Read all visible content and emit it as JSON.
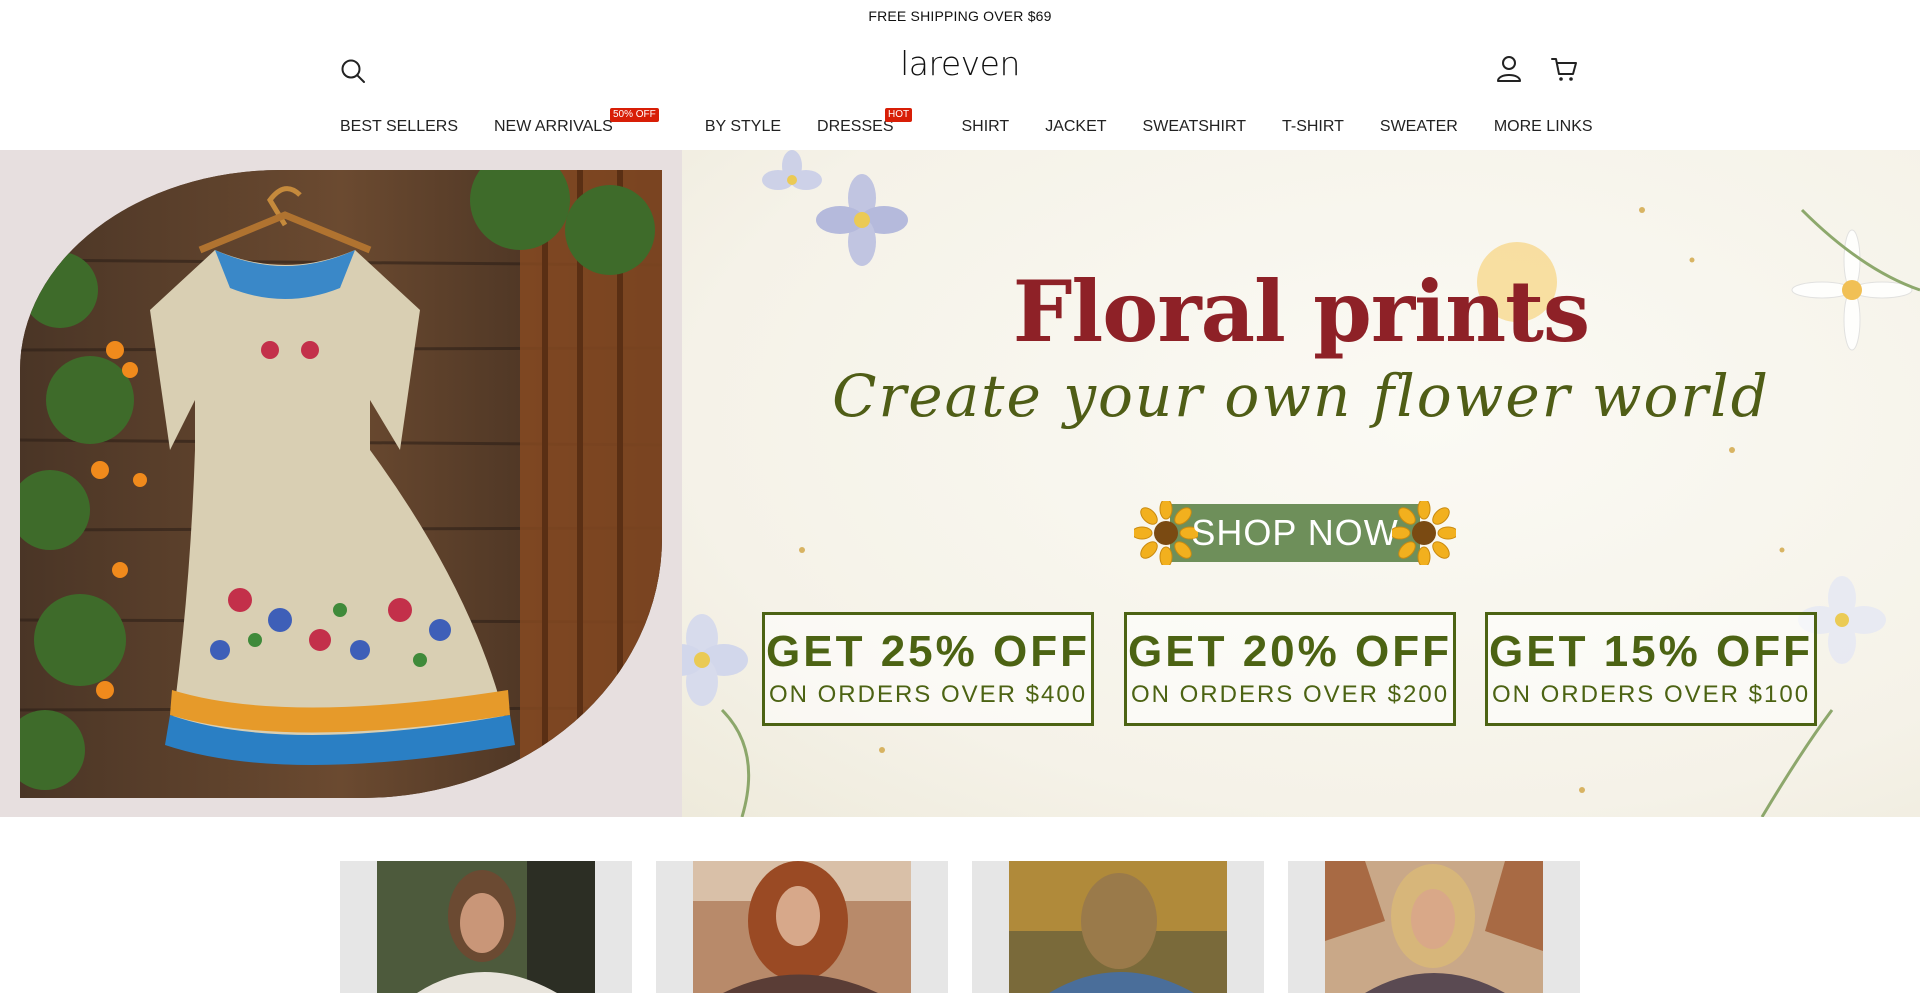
{
  "announcement": "FREE SHIPPING OVER $69",
  "header": {
    "logo": "lareven",
    "icons": {
      "search": "search-icon",
      "account": "user-icon",
      "cart": "cart-icon"
    }
  },
  "nav": [
    {
      "label": "BEST SELLERS",
      "badge": ""
    },
    {
      "label": "NEW ARRIVALS",
      "badge": "50% OFF"
    },
    {
      "label": "BY STYLE",
      "badge": ""
    },
    {
      "label": "DRESSES",
      "badge": "HOT"
    },
    {
      "label": "SHIRT",
      "badge": ""
    },
    {
      "label": "JACKET",
      "badge": ""
    },
    {
      "label": "SWEATSHIRT",
      "badge": ""
    },
    {
      "label": "T-SHIRT",
      "badge": ""
    },
    {
      "label": "SWEATER",
      "badge": ""
    },
    {
      "label": "MORE LINKS",
      "badge": ""
    }
  ],
  "hero": {
    "title": "Floral prints",
    "subtitle": "Create your own flower world",
    "cta": "SHOP NOW",
    "offers": [
      {
        "headline": "GET 25% OFF",
        "condition": "ON ORDERS OVER $400"
      },
      {
        "headline": "GET 20% OFF",
        "condition": "ON ORDERS OVER $200"
      },
      {
        "headline": "GET 15% OFF",
        "condition": "ON ORDERS OVER $100"
      }
    ]
  },
  "colors": {
    "title": "#8e2127",
    "subtitle": "#4f5d16",
    "cta_bg": "#6e8f5a",
    "offer": "#4c6313",
    "badge": "#d81e06"
  }
}
